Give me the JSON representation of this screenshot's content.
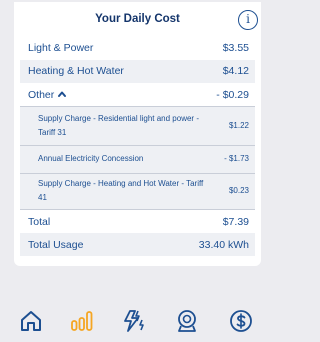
{
  "card": {
    "title": "Your Daily Cost",
    "info_icon": "i",
    "rows": [
      {
        "label": "Light & Power",
        "value": "$3.55"
      },
      {
        "label": "Heating & Hot Water",
        "value": "$4.12"
      }
    ],
    "other": {
      "label": "Other",
      "value": "- $0.29"
    },
    "sub_items": [
      {
        "label": "Supply Charge - Residential light and power - Tariff 31",
        "value": "$1.22"
      },
      {
        "label": "Annual Electricity Concession",
        "value": "- $1.73"
      },
      {
        "label": "Supply Charge - Heating and Hot Water - Tariff 41",
        "value": "$0.23"
      }
    ],
    "total": {
      "label": "Total",
      "value": "$7.39"
    },
    "total_usage": {
      "label": "Total Usage",
      "value": "33.40 kWh"
    }
  },
  "tabbar": {
    "items": [
      {
        "icon": "home-icon",
        "active": false
      },
      {
        "icon": "bar-chart-icon",
        "active": true
      },
      {
        "icon": "energy-bolt-icon",
        "active": false
      },
      {
        "icon": "meter-icon",
        "active": false
      },
      {
        "icon": "dollar-icon",
        "active": false
      }
    ]
  },
  "colors": {
    "primary": "#1d4f91",
    "active_tab": "#f5a623",
    "row_shade": "#eef0f4",
    "background": "#ececf0"
  }
}
